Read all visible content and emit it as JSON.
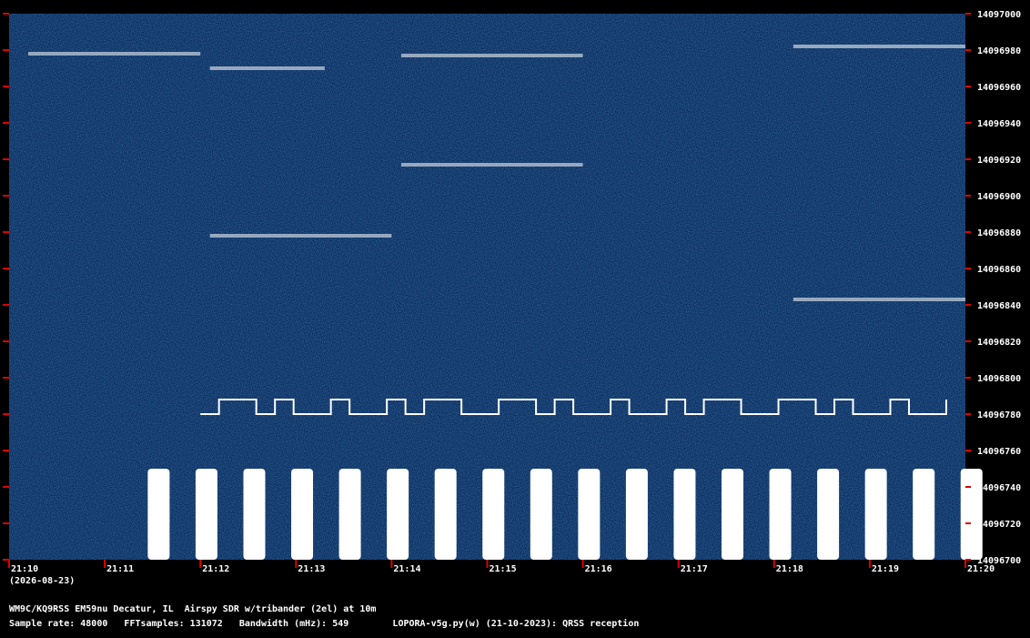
{
  "chart_data": {
    "type": "heatmap",
    "title": "",
    "xlabel": "",
    "ylabel": "",
    "x_ticks": [
      "21:10",
      "21:11",
      "21:12",
      "21:13",
      "21:14",
      "21:15",
      "21:16",
      "21:17",
      "21:18",
      "21:19",
      "21:20"
    ],
    "date_label": "(2026-08-23)",
    "y_ticks": [
      14097000,
      14096980,
      14096960,
      14096940,
      14096920,
      14096900,
      14096880,
      14096860,
      14096840,
      14096820,
      14096800,
      14096780,
      14096760,
      14096740,
      14096720,
      14096700
    ],
    "ylim": [
      14096700,
      14097000
    ],
    "xlim_minutes": [
      0,
      10
    ],
    "signals": [
      {
        "kind": "cw-trace",
        "t_start": 0.2,
        "t_end": 2.0,
        "freq": 14096978
      },
      {
        "kind": "cw-trace",
        "t_start": 2.1,
        "t_end": 3.3,
        "freq": 14096970
      },
      {
        "kind": "cw-trace",
        "t_start": 4.1,
        "t_end": 6.0,
        "freq": 14096977
      },
      {
        "kind": "cw-trace",
        "t_start": 4.1,
        "t_end": 6.0,
        "freq": 14096917
      },
      {
        "kind": "cw-trace",
        "t_start": 2.1,
        "t_end": 4.0,
        "freq": 14096878
      },
      {
        "kind": "cw-trace",
        "t_start": 8.2,
        "t_end": 10.0,
        "freq": 14096982
      },
      {
        "kind": "cw-trace",
        "t_start": 8.2,
        "t_end": 10.0,
        "freq": 14096843
      },
      {
        "kind": "fsk-trace",
        "t_start": 2.0,
        "t_end": 9.8,
        "freq_low": 14096780,
        "freq_high": 14096788
      },
      {
        "kind": "burst-band",
        "freq_low": 14096700,
        "freq_high": 14096750,
        "period_minutes": 0.5,
        "t_first": 1.45
      }
    ],
    "background_color": "#0a2a5c",
    "signal_color": "#ffffff",
    "tick_color": "#e00000"
  },
  "info": {
    "line1": "WM9C/KQ9RSS EM59nu Decatur, IL  Airspy SDR w/tribander (2el) at 10m",
    "line2": "Sample rate: 48000   FFTsamples: 131072   Bandwidth (mHz): 549        LOPORA-v5g.py(w) (21-10-2023): QRSS reception"
  }
}
